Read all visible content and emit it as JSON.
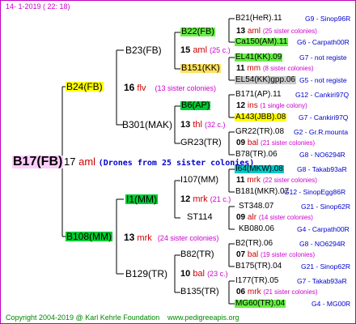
{
  "header": {
    "date": "14-  1-2019 (  22:  18)"
  },
  "root": {
    "name": "B17(FB)",
    "num": "17",
    "code": "aml",
    "note": "(Drones from 25 sister colonies)"
  },
  "gen1": [
    {
      "name": "B24(FB)",
      "num": "16",
      "code": "flv",
      "note": "(13 sister colonies)"
    },
    {
      "name": "B108(MM)",
      "num": "13",
      "code": "mrk",
      "note": "(24 sister colonies)"
    }
  ],
  "gen2": [
    {
      "name": "B23(FB)",
      "num": "15",
      "code": "aml",
      "note": "(25 c.)"
    },
    {
      "name": "B301(MAK)",
      "num": "13",
      "code": "thl",
      "note": "(32 c.)"
    },
    {
      "name": "I1(MM)",
      "num": "12",
      "code": "mrk",
      "note": "(21 c.)"
    },
    {
      "name": "B129(TR)",
      "num": "10",
      "code": "bal",
      "note": "(23 c.)"
    }
  ],
  "gen3": [
    {
      "name": "B22(FB)",
      "num": "13",
      "code": "aml",
      "note": "(25 sister colonies)"
    },
    {
      "name": "B151(KK)",
      "num": "11",
      "code": "mm",
      "note": "(8 sister colonies)"
    },
    {
      "name": "B6(AP)",
      "num": "12",
      "code": "ins",
      "note": "(1 single colony)"
    },
    {
      "name": "GR23(TR)",
      "num": "09",
      "code": "bal",
      "note": "(21 sister colonies)"
    },
    {
      "name": "I107(MM)",
      "num": "11",
      "code": "mrk",
      "note": "(22 sister colonies)"
    },
    {
      "name": "ST114",
      "num": "09",
      "code": "alr",
      "note": "(14 sister colonies)"
    },
    {
      "name": "B82(TR)",
      "num": "07",
      "code": "bal",
      "note": "(19 sister colonies)"
    },
    {
      "name": "B135(TR)",
      "num": "06",
      "code": "mrk",
      "note": "(21 sister colonies)"
    }
  ],
  "gen4": [
    {
      "name": "B21(HeR).11",
      "info": "G9 - Sinop96R"
    },
    {
      "name": "Ca150(AM).11",
      "info": "G6 - Carpath00R"
    },
    {
      "name": "EL41(KK).09",
      "info": "G7 - not registe"
    },
    {
      "name": "EL54(KK)gpp.06",
      "info": "G5 - not registe"
    },
    {
      "name": "B171(AP).11",
      "info": "G12 - Cankiri97Q"
    },
    {
      "name": "A143(JBB).08",
      "info": "G7 - Cankiri97Q"
    },
    {
      "name": "GR22(TR).08",
      "info": "G2 - Gr.R.mounta"
    },
    {
      "name": "B78(TR).06",
      "info": "G8 - NO6294R"
    },
    {
      "name": "I64(MKW).08",
      "info": "G8 - Takab93aR"
    },
    {
      "name": "B181(MKR).07",
      "info": "G12 - SinopEgg86R"
    },
    {
      "name": "ST348.07",
      "info": "G21 - Sinop62R"
    },
    {
      "name": "KB080.06",
      "info": "G4 - Carpath00R"
    },
    {
      "name": "B2(TR).06",
      "info": "G8 - NO6294R"
    },
    {
      "name": "B175(TR).04",
      "info": "G21 - Sinop62R"
    },
    {
      "name": "I177(TR).05",
      "info": "G7 - Takab93aR"
    },
    {
      "name": "MG60(TR).04",
      "info": "G4 - MG00R"
    }
  ],
  "footer": {
    "copyright": "Copyright 2004-2019 @ Karl Kehrle Foundation",
    "url": "www.pedigreeapis.org"
  }
}
